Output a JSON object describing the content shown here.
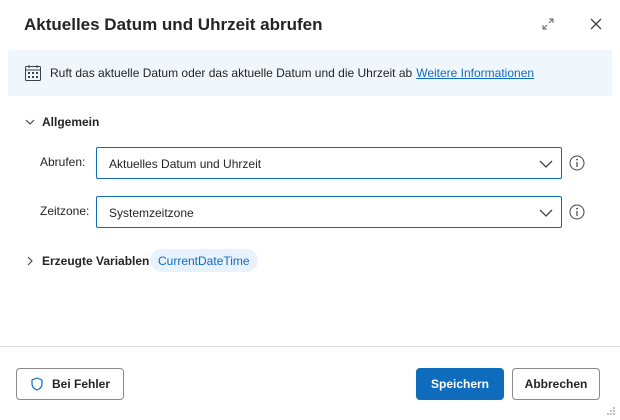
{
  "dialog": {
    "title": "Aktuelles Datum und Uhrzeit abrufen",
    "expand_icon": "expand-icon",
    "close_icon": "close-icon"
  },
  "info_bar": {
    "icon": "calendar-icon",
    "text": "Ruft das aktuelle Datum oder das aktuelle Datum und die Uhrzeit ab",
    "link": "Weitere Informationen"
  },
  "general": {
    "label": "Allgemein",
    "fields": [
      {
        "label": "Abrufen:",
        "value": "Aktuelles Datum und Uhrzeit"
      },
      {
        "label": "Zeitzone:",
        "value": "Systemzeitzone"
      }
    ]
  },
  "variables": {
    "label": "Erzeugte Variablen",
    "pill": "CurrentDateTime"
  },
  "footer": {
    "error_label": "Bei Fehler",
    "save_label": "Speichern",
    "cancel_label": "Abbrechen"
  },
  "colors": {
    "accent": "#0f6cbd",
    "info_bg": "#eff6fc",
    "pill_bg": "#e8f2fc"
  }
}
